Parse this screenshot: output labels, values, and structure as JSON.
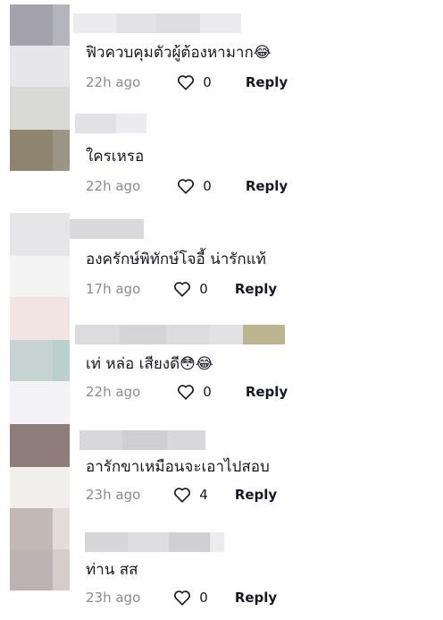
{
  "comments": [
    {
      "text": "ฟิวควบคุมตัวผู้ต้องหามาก😂",
      "time": "22h ago",
      "likes": "0",
      "reply": "Reply"
    },
    {
      "text": "ใครเหรอ",
      "time": "22h ago",
      "likes": "0",
      "reply": "Reply"
    },
    {
      "text": "องครักษ์พิทักษ์โจอี้ น่ารักแท้",
      "time": "17h ago",
      "likes": "0",
      "reply": "Reply"
    },
    {
      "text": "เท่ หล่อ เสียงดี😳😂",
      "time": "22h ago",
      "likes": "0",
      "reply": "Reply"
    },
    {
      "text": "อารักขาเหมือนจะเอาไปสอบ",
      "time": "23h ago",
      "likes": "4",
      "reply": "Reply"
    },
    {
      "text": "ท่าน สส",
      "time": "23h ago",
      "likes": "0",
      "reply": "Reply"
    }
  ],
  "colors": {
    "text": "#161823",
    "time": "#8a8b91",
    "accent": "#f5c53d"
  },
  "icons": {
    "like": "heart-outline-icon"
  }
}
